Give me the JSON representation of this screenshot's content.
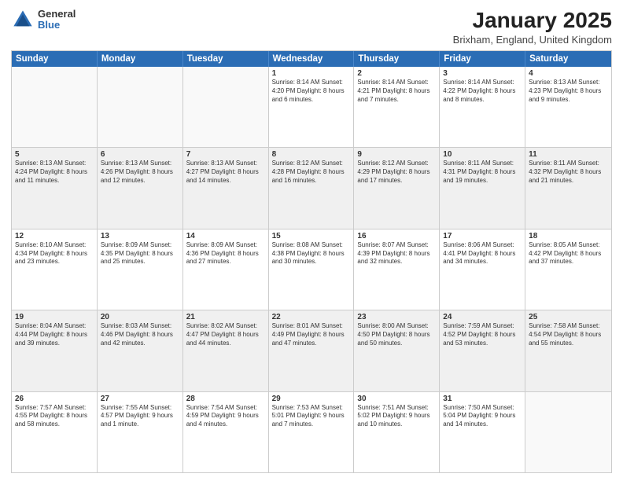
{
  "header": {
    "logo_general": "General",
    "logo_blue": "Blue",
    "month_title": "January 2025",
    "location": "Brixham, England, United Kingdom"
  },
  "weekdays": [
    "Sunday",
    "Monday",
    "Tuesday",
    "Wednesday",
    "Thursday",
    "Friday",
    "Saturday"
  ],
  "weeks": [
    [
      {
        "day": "",
        "text": "",
        "empty": true
      },
      {
        "day": "",
        "text": "",
        "empty": true
      },
      {
        "day": "",
        "text": "",
        "empty": true
      },
      {
        "day": "1",
        "text": "Sunrise: 8:14 AM\nSunset: 4:20 PM\nDaylight: 8 hours and 6 minutes.",
        "empty": false
      },
      {
        "day": "2",
        "text": "Sunrise: 8:14 AM\nSunset: 4:21 PM\nDaylight: 8 hours and 7 minutes.",
        "empty": false
      },
      {
        "day": "3",
        "text": "Sunrise: 8:14 AM\nSunset: 4:22 PM\nDaylight: 8 hours and 8 minutes.",
        "empty": false
      },
      {
        "day": "4",
        "text": "Sunrise: 8:13 AM\nSunset: 4:23 PM\nDaylight: 8 hours and 9 minutes.",
        "empty": false
      }
    ],
    [
      {
        "day": "5",
        "text": "Sunrise: 8:13 AM\nSunset: 4:24 PM\nDaylight: 8 hours and 11 minutes.",
        "empty": false
      },
      {
        "day": "6",
        "text": "Sunrise: 8:13 AM\nSunset: 4:26 PM\nDaylight: 8 hours and 12 minutes.",
        "empty": false
      },
      {
        "day": "7",
        "text": "Sunrise: 8:13 AM\nSunset: 4:27 PM\nDaylight: 8 hours and 14 minutes.",
        "empty": false
      },
      {
        "day": "8",
        "text": "Sunrise: 8:12 AM\nSunset: 4:28 PM\nDaylight: 8 hours and 16 minutes.",
        "empty": false
      },
      {
        "day": "9",
        "text": "Sunrise: 8:12 AM\nSunset: 4:29 PM\nDaylight: 8 hours and 17 minutes.",
        "empty": false
      },
      {
        "day": "10",
        "text": "Sunrise: 8:11 AM\nSunset: 4:31 PM\nDaylight: 8 hours and 19 minutes.",
        "empty": false
      },
      {
        "day": "11",
        "text": "Sunrise: 8:11 AM\nSunset: 4:32 PM\nDaylight: 8 hours and 21 minutes.",
        "empty": false
      }
    ],
    [
      {
        "day": "12",
        "text": "Sunrise: 8:10 AM\nSunset: 4:34 PM\nDaylight: 8 hours and 23 minutes.",
        "empty": false
      },
      {
        "day": "13",
        "text": "Sunrise: 8:09 AM\nSunset: 4:35 PM\nDaylight: 8 hours and 25 minutes.",
        "empty": false
      },
      {
        "day": "14",
        "text": "Sunrise: 8:09 AM\nSunset: 4:36 PM\nDaylight: 8 hours and 27 minutes.",
        "empty": false
      },
      {
        "day": "15",
        "text": "Sunrise: 8:08 AM\nSunset: 4:38 PM\nDaylight: 8 hours and 30 minutes.",
        "empty": false
      },
      {
        "day": "16",
        "text": "Sunrise: 8:07 AM\nSunset: 4:39 PM\nDaylight: 8 hours and 32 minutes.",
        "empty": false
      },
      {
        "day": "17",
        "text": "Sunrise: 8:06 AM\nSunset: 4:41 PM\nDaylight: 8 hours and 34 minutes.",
        "empty": false
      },
      {
        "day": "18",
        "text": "Sunrise: 8:05 AM\nSunset: 4:42 PM\nDaylight: 8 hours and 37 minutes.",
        "empty": false
      }
    ],
    [
      {
        "day": "19",
        "text": "Sunrise: 8:04 AM\nSunset: 4:44 PM\nDaylight: 8 hours and 39 minutes.",
        "empty": false
      },
      {
        "day": "20",
        "text": "Sunrise: 8:03 AM\nSunset: 4:46 PM\nDaylight: 8 hours and 42 minutes.",
        "empty": false
      },
      {
        "day": "21",
        "text": "Sunrise: 8:02 AM\nSunset: 4:47 PM\nDaylight: 8 hours and 44 minutes.",
        "empty": false
      },
      {
        "day": "22",
        "text": "Sunrise: 8:01 AM\nSunset: 4:49 PM\nDaylight: 8 hours and 47 minutes.",
        "empty": false
      },
      {
        "day": "23",
        "text": "Sunrise: 8:00 AM\nSunset: 4:50 PM\nDaylight: 8 hours and 50 minutes.",
        "empty": false
      },
      {
        "day": "24",
        "text": "Sunrise: 7:59 AM\nSunset: 4:52 PM\nDaylight: 8 hours and 53 minutes.",
        "empty": false
      },
      {
        "day": "25",
        "text": "Sunrise: 7:58 AM\nSunset: 4:54 PM\nDaylight: 8 hours and 55 minutes.",
        "empty": false
      }
    ],
    [
      {
        "day": "26",
        "text": "Sunrise: 7:57 AM\nSunset: 4:55 PM\nDaylight: 8 hours and 58 minutes.",
        "empty": false
      },
      {
        "day": "27",
        "text": "Sunrise: 7:55 AM\nSunset: 4:57 PM\nDaylight: 9 hours and 1 minute.",
        "empty": false
      },
      {
        "day": "28",
        "text": "Sunrise: 7:54 AM\nSunset: 4:59 PM\nDaylight: 9 hours and 4 minutes.",
        "empty": false
      },
      {
        "day": "29",
        "text": "Sunrise: 7:53 AM\nSunset: 5:01 PM\nDaylight: 9 hours and 7 minutes.",
        "empty": false
      },
      {
        "day": "30",
        "text": "Sunrise: 7:51 AM\nSunset: 5:02 PM\nDaylight: 9 hours and 10 minutes.",
        "empty": false
      },
      {
        "day": "31",
        "text": "Sunrise: 7:50 AM\nSunset: 5:04 PM\nDaylight: 9 hours and 14 minutes.",
        "empty": false
      },
      {
        "day": "",
        "text": "",
        "empty": true
      }
    ]
  ]
}
